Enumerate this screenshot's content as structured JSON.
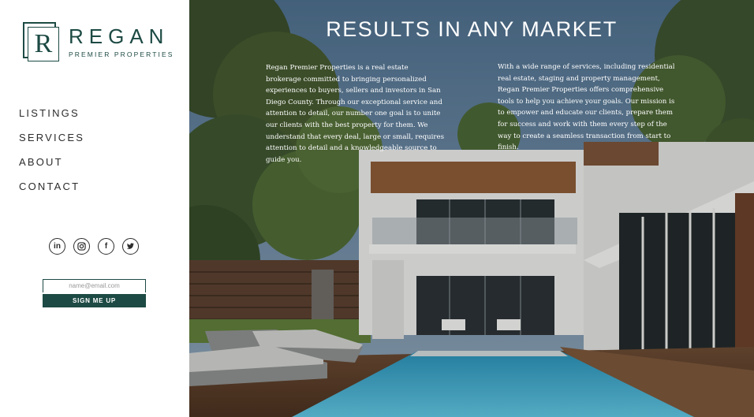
{
  "brand": {
    "mark_letter": "R",
    "name": "REGAN",
    "tagline": "PREMIER PROPERTIES"
  },
  "nav": {
    "items": [
      {
        "label": "LISTINGS"
      },
      {
        "label": "SERVICES"
      },
      {
        "label": "ABOUT"
      },
      {
        "label": "CONTACT"
      }
    ]
  },
  "socials": [
    {
      "name": "linkedin-icon",
      "glyph": "in"
    },
    {
      "name": "instagram-icon",
      "glyph": ""
    },
    {
      "name": "facebook-icon",
      "glyph": "f"
    },
    {
      "name": "twitter-icon",
      "glyph": ""
    }
  ],
  "signup": {
    "placeholder": "name@email.com",
    "button_label": "SIGN ME UP"
  },
  "hero": {
    "headline": "RESULTS IN ANY MARKET",
    "paragraph_left": "Regan Premier Properties is a real estate brokerage committed to bringing personalized experiences to buyers, sellers and investors in San Diego County. Through our exceptional service and attention to detail, our number one goal is to unite our clients with the best property for them. We understand that every deal, large or small, requires attention to detail and a knowledgeable source to guide you.",
    "paragraph_right": "With a wide range of services, including residential real estate, staging and property management, Regan Premier Properties offers comprehensive tools to help you achieve your goals. Our mission is to empower and educate our clients, prepare them for success and work with them every step of the way to create a seamless transaction from start to finish."
  },
  "colors": {
    "brand_green": "#1d4a44",
    "text_dark": "#2c2c2c"
  }
}
